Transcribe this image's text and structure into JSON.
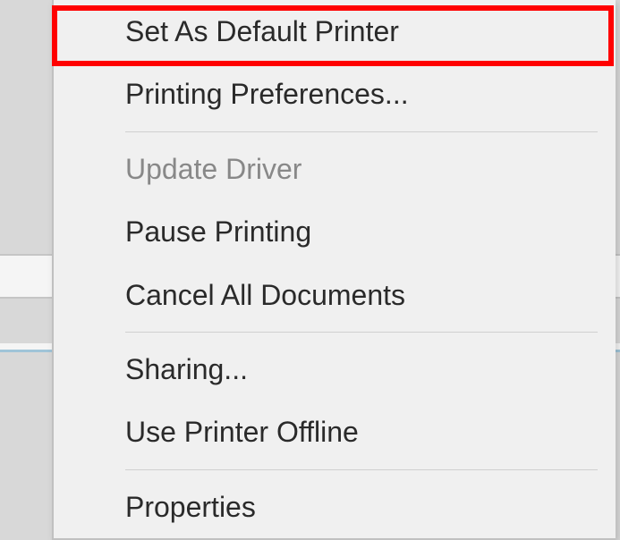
{
  "menu": {
    "items": [
      {
        "label": "Set As Default Printer",
        "enabled": true
      },
      {
        "label": "Printing Preferences...",
        "enabled": true
      },
      {
        "label": "Update Driver",
        "enabled": false
      },
      {
        "label": "Pause Printing",
        "enabled": true
      },
      {
        "label": "Cancel All Documents",
        "enabled": true
      },
      {
        "label": "Sharing...",
        "enabled": true
      },
      {
        "label": "Use Printer Offline",
        "enabled": true
      },
      {
        "label": "Properties",
        "enabled": true
      }
    ]
  },
  "highlight": {
    "color": "#ff0000"
  }
}
